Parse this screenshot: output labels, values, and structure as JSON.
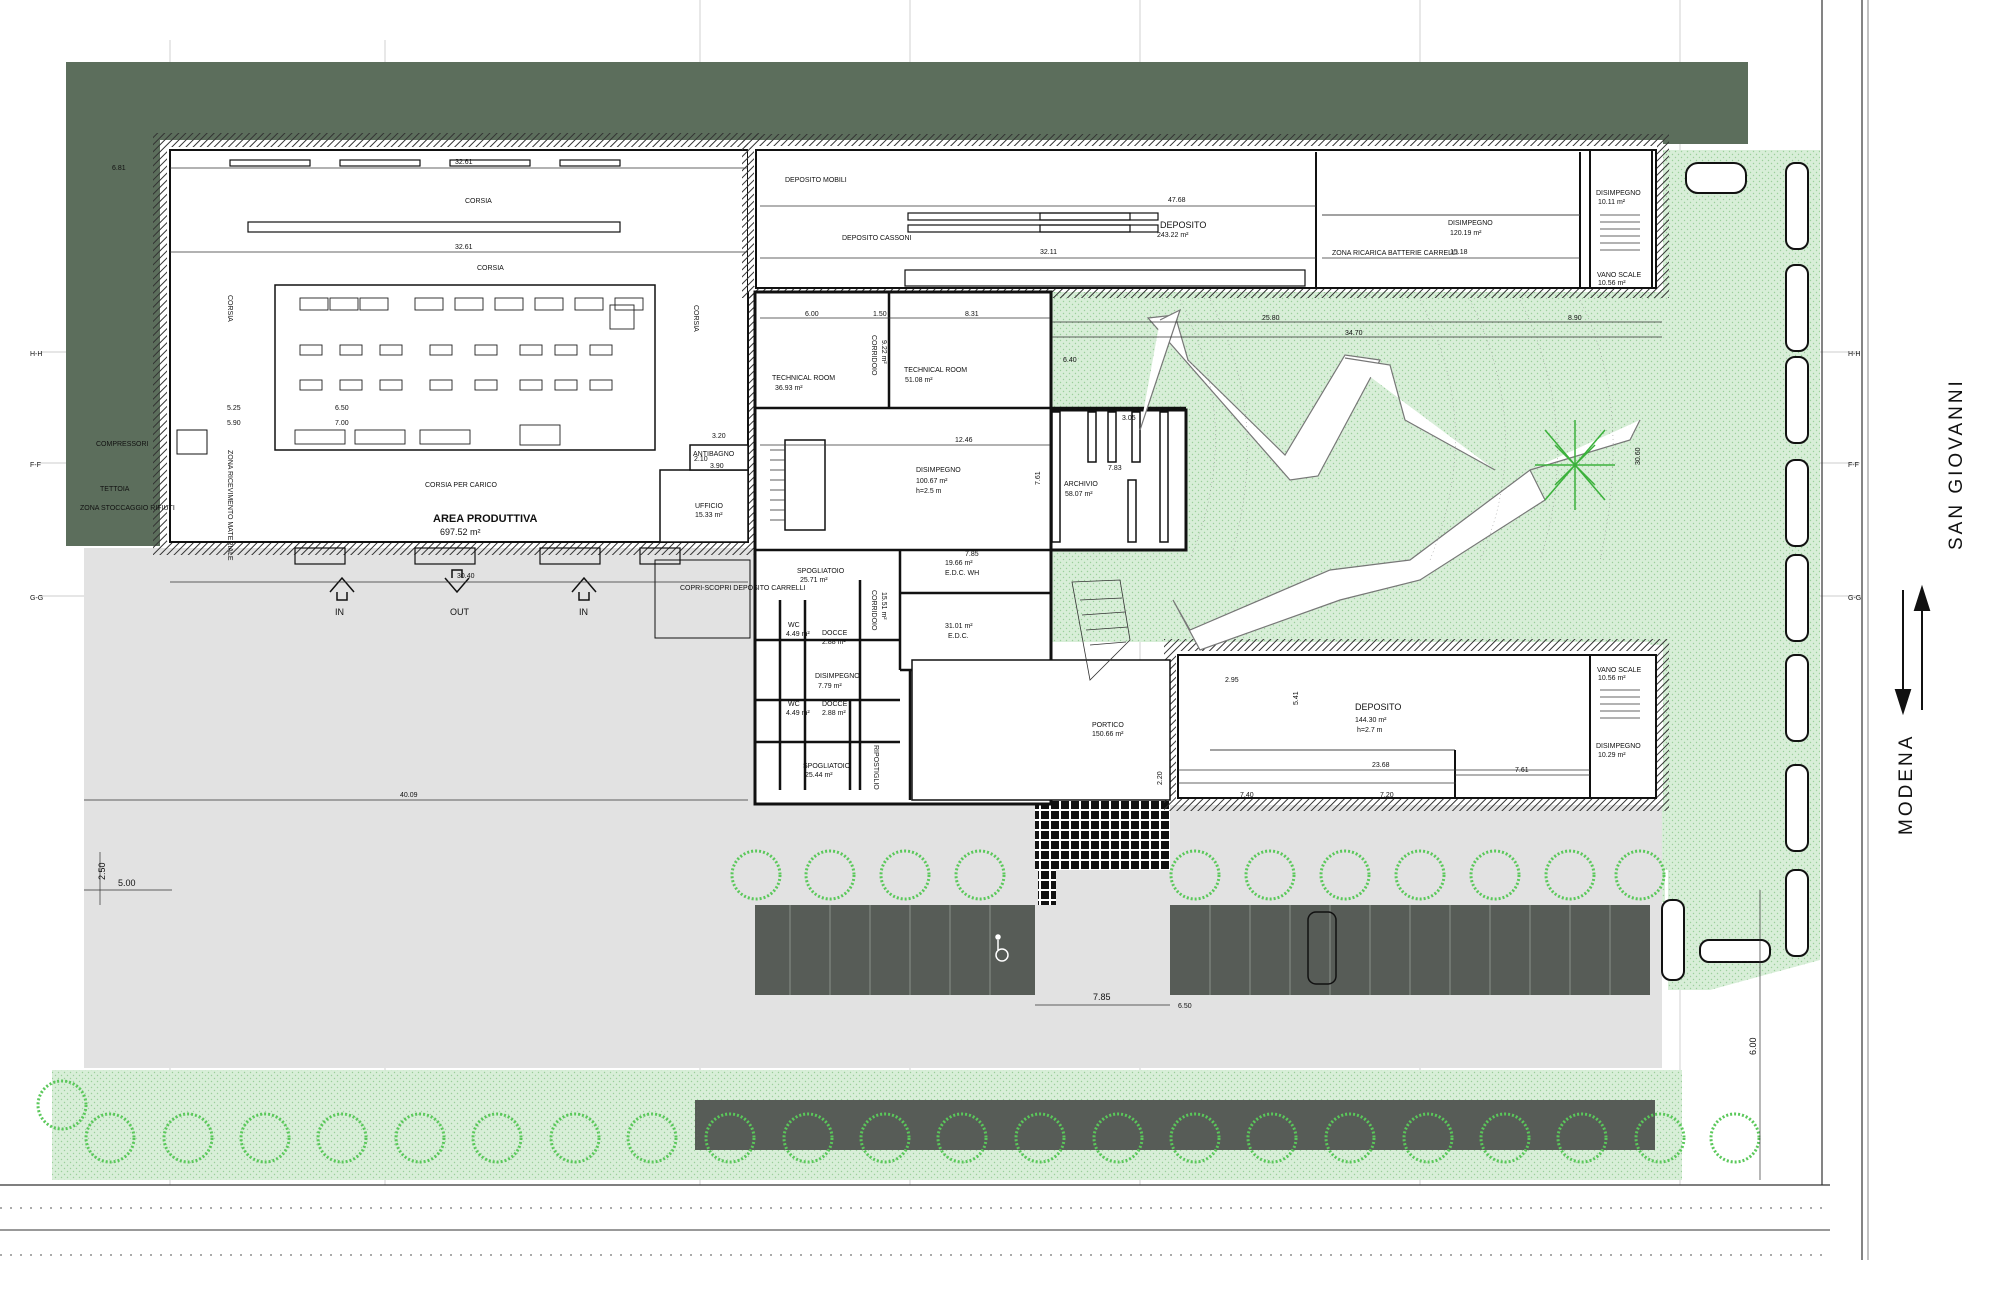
{
  "colors": {
    "dark_green": "#5c6e5c",
    "light_green": "#d8eed8",
    "paving": "#e2e2e2",
    "tree_green": "#5ac85a",
    "parking_dark": "#575c57"
  },
  "section_marks": {
    "hh": "H-H",
    "ff": "F-F",
    "gg": "G-G"
  },
  "streets": {
    "modena": "MODENA",
    "san_giovanni": "SAN GIOVANNI"
  },
  "rooms": {
    "corsia_top": "CORSIA",
    "corsia_mid": "CORSIA",
    "corsia_left": "CORSIA",
    "corsia_right": "CORSIA",
    "corsia_carico": "CORSIA PER CARICO",
    "area_produttiva_name": "AREA PRODUTTIVA",
    "area_produttiva_area": "697.52 m²",
    "zona_ricevimento": "ZONA RICEVIMENTO MATERIALE",
    "compressori": "COMPRESSORI",
    "tettoia": "TETTOIA",
    "zona_stoccaggio": "ZONA STOCCAGGIO RIFIUTI",
    "ufficio_name": "UFFICIO",
    "ufficio_area": "15.33 m²",
    "antibagno": "ANTIBAGNO",
    "deposito_rifiuti": "COPRI-SCOPRI DEPOSITO CARRELLI",
    "deposito_small": "DEPOSITO MOBILI",
    "deposito_cassoni": "DEPOSITO CASSONI",
    "deposito_main_name": "DEPOSITO",
    "deposito_main_area": "243.22 m²",
    "zona_ricarica": "ZONA RICARICA BATTERIE CARRELLI",
    "disimpegno_ne_name": "DISIMPEGNO",
    "disimpegno_ne_area": "120.19 m²",
    "disimpegno_stair_name": "DISIMPEGNO",
    "disimpegno_stair_area": "10.11 m²",
    "vano_scale_n_name": "VANO SCALE",
    "vano_scale_n_area": "10.56 m²",
    "tech1_name": "TECHNICAL ROOM",
    "tech1_area": "36.93 m²",
    "corridoio1_name": "CORRIDOIO",
    "corridoio1_area": "9.22 m²",
    "tech2_name": "TECHNICAL ROOM",
    "tech2_area": "51.08 m²",
    "disimpegno_c_name": "DISIMPEGNO",
    "disimpegno_c_area": "100.67 m²",
    "disimpegno_c_h": "h=2.5 m",
    "archivio_name": "ARCHIVIO",
    "archivio_area": "58.07 m²",
    "spogliatoio1_name": "SPOGLIATOIO",
    "spogliatoio1_area": "25.71 m²",
    "corridoio2_name": "CORRIDOIO",
    "corridoio2_area": "15.51 m²",
    "edc_wh_area": "19.66 m²",
    "edc_wh_name": "E.D.C. WH",
    "edc_area": "31.01 m²",
    "edc_name": "E.D.C.",
    "docce1_name": "DOCCE",
    "docce1_area": "2.88 m²",
    "wc1_name": "WC",
    "wc1_area": "4.49 m²",
    "disimpegno_s_name": "DISIMPEGNO",
    "disimpegno_s_area": "7.79 m²",
    "docce2_name": "DOCCE",
    "docce2_area": "2.88 m²",
    "wc2_name": "WC",
    "wc2_area": "4.49 m²",
    "spogliatoio2_name": "SPOGLIATOIO",
    "spogliatoio2_area": "25.44 m²",
    "ripostiglio_name": "RIPOSTIGLIO",
    "portico_name": "PORTICO",
    "portico_area": "150.66 m²",
    "deposito_s_name": "DEPOSITO",
    "deposito_s_area": "144.30 m²",
    "deposito_s_h": "h=2.7 m",
    "vano_scale_s_name": "VANO SCALE",
    "vano_scale_s_area": "10.56 m²",
    "disimpegno_s2_name": "DISIMPEGNO",
    "disimpegno_s2_area": "10.29 m²"
  },
  "doors": {
    "in1": "IN",
    "out": "OUT",
    "in2": "IN"
  },
  "dims": {
    "d_6_81": "6.81",
    "d_32_61": "32.61",
    "d_32_61_b": "32.61",
    "d_47_68": "47.68",
    "d_32_11": "32.11",
    "d_15_18": "15.18",
    "d_30_40": "30.40",
    "d_40_09": "40.09",
    "d_2_50": "2.50",
    "d_5_00": "5.00",
    "d_7_85": "7.85",
    "d_6_00": "6.00",
    "d_25_80": "25.80",
    "d_34_70": "34.70",
    "d_8_90": "8.90",
    "d_12_46": "12.46",
    "d_6_00_b": "6.00",
    "d_8_31": "8.31",
    "d_1_50": "1.50",
    "d_5_25": "5.25",
    "d_6_50": "6.50",
    "d_7_00": "7.00",
    "d_5_90": "5.90",
    "d_7_40": "7.40",
    "d_7_20": "7.20",
    "d_23_68": "23.68",
    "d_7_61": "7.61",
    "d_30_60": "30.60",
    "d_3_20": "3.20",
    "d_3_90": "3.90",
    "d_2_10": "2.10",
    "d_6_40": "6.40",
    "d_5_41": "5.41",
    "d_2_95": "2.95",
    "d_7_83": "7.83",
    "d_7_61_b": "7.61",
    "d_7_85_b": "7.85",
    "d_3_05": "3.05",
    "d_6_50_b": "6.50",
    "d_2_20": "2.20"
  }
}
